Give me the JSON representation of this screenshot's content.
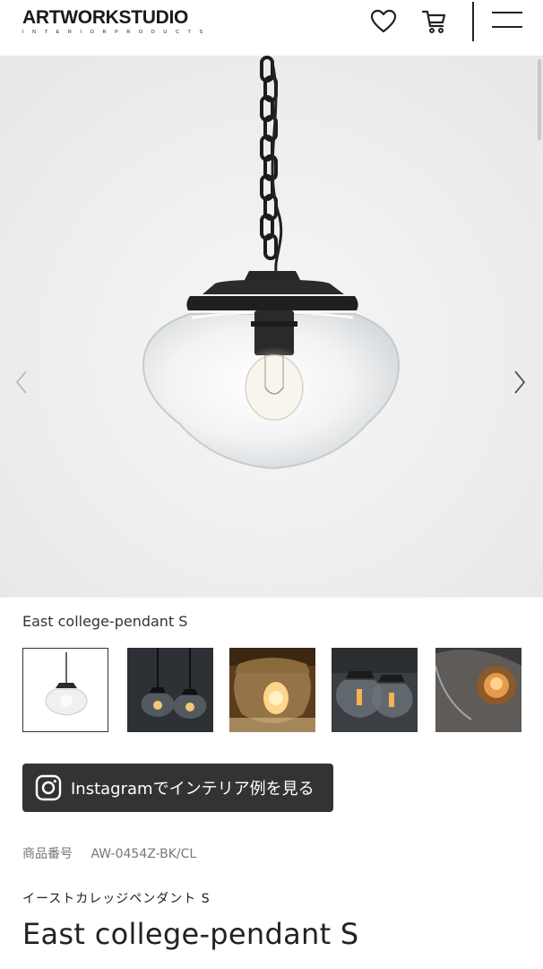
{
  "header": {
    "logo_main": "ARTWORKSTUDIO",
    "logo_sub": "INTERIORPRODUCTS",
    "icons": [
      "heart-icon",
      "cart-icon",
      "menu-icon"
    ]
  },
  "hero": {
    "image": "pendant-lamp-photo",
    "prev_icon": "chevron-left-icon",
    "next_icon": "chevron-right-icon"
  },
  "product": {
    "name_small": "East college-pendant S",
    "thumbnails": [
      {
        "name": "thumbnail-1",
        "selected": true
      },
      {
        "name": "thumbnail-2",
        "selected": false
      },
      {
        "name": "thumbnail-3",
        "selected": false
      },
      {
        "name": "thumbnail-4",
        "selected": false
      },
      {
        "name": "thumbnail-5",
        "selected": false
      }
    ],
    "instagram_label": "Instagramでインテリア例を見る",
    "number_label": "商品番号",
    "number_value": "AW-0454Z-BK/CL",
    "name_jp": "イーストカレッジペンダント S",
    "name_en": "East college-pendant S"
  },
  "colors": {
    "dark": "#333333",
    "hero_bg": "#efefef"
  }
}
